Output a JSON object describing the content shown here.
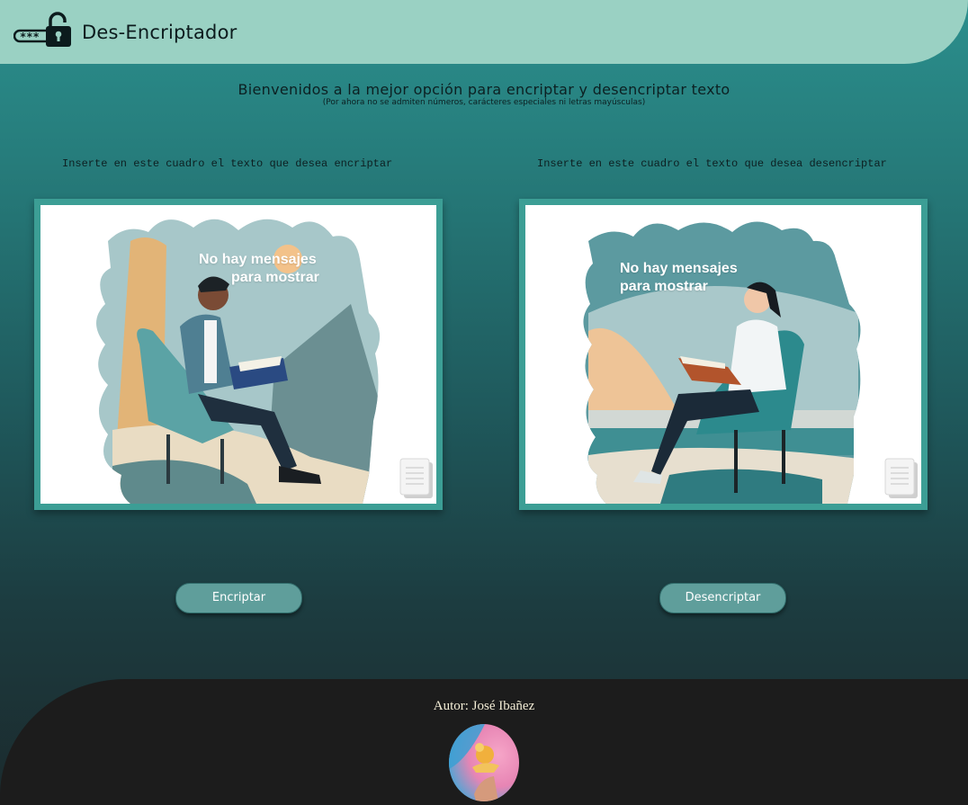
{
  "header": {
    "title": "Des-Encriptador",
    "logo_icon": "unlocked-padlock-password-icon",
    "background": "#9ad1c3"
  },
  "welcome": {
    "headline": "Bienvenidos a la mejor opción para encriptar y desencriptar texto",
    "note": "(Por ahora no se admiten números, carácteres especiales ni letras mayúsculas)"
  },
  "encrypt_panel": {
    "instruction": "Inserte en este cuadro el texto que desea encriptar",
    "message_line1": "No hay mensajes",
    "message_line2": "para mostrar",
    "illustration": "man-reading-in-chair",
    "corner_icon": "document-stack-icon"
  },
  "decrypt_panel": {
    "instruction": "Inserte en este cuadro el texto que desea desencriptar",
    "message_line1": "No hay mensajes",
    "message_line2": "para mostrar",
    "illustration": "woman-reading-in-chair",
    "corner_icon": "document-stack-icon"
  },
  "buttons": {
    "encrypt_label": "Encriptar",
    "decrypt_label": "Desencriptar",
    "color": "#5f9e9b"
  },
  "footer": {
    "author": "Autor: José Ibañez",
    "avatar_icon": "author-avatar"
  },
  "colors": {
    "panel_border": "#3c9e95",
    "footer_background": "#1c1c1c"
  }
}
